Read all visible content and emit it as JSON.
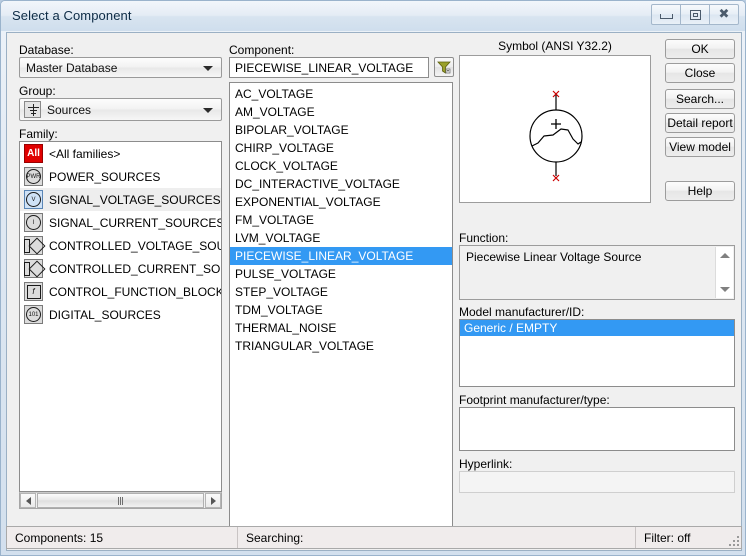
{
  "window": {
    "title": "Select a Component",
    "caption_buttons": [
      {
        "name": "minimize",
        "glyph": "minimize-icon"
      },
      {
        "name": "maximize",
        "glyph": "maximize-icon"
      },
      {
        "name": "close",
        "glyph": "close-icon"
      }
    ]
  },
  "left": {
    "database_label": "Database:",
    "database_value": "Master Database",
    "group_label": "Group:",
    "group_value": "Sources",
    "family_label": "Family:",
    "families": [
      {
        "label": "<All families>",
        "icon": "all-families-icon",
        "badge": "All",
        "selected": false
      },
      {
        "label": "POWER_SOURCES",
        "icon": "power-sources-icon",
        "badge": "PWR",
        "selected": false
      },
      {
        "label": "SIGNAL_VOLTAGE_SOURCES",
        "icon": "signal-voltage-sources-icon",
        "badge": "V",
        "selected": true
      },
      {
        "label": "SIGNAL_CURRENT_SOURCES",
        "icon": "signal-current-sources-icon",
        "badge": "I",
        "selected": false
      },
      {
        "label": "CONTROLLED_VOLTAGE_SOURCES",
        "icon": "controlled-voltage-sources-icon",
        "badge": "",
        "selected": false
      },
      {
        "label": "CONTROLLED_CURRENT_SOURCES",
        "icon": "controlled-current-sources-icon",
        "badge": "",
        "selected": false
      },
      {
        "label": "CONTROL_FUNCTION_BLOCKS",
        "icon": "control-function-blocks-icon",
        "badge": "f",
        "selected": false
      },
      {
        "label": "DIGITAL_SOURCES",
        "icon": "digital-sources-icon",
        "badge": "101",
        "selected": false
      }
    ]
  },
  "component": {
    "label": "Component:",
    "value": "PIECEWISE_LINEAR_VOLTAGE",
    "placeholder": "",
    "filter_icon": "filter-funnel-icon",
    "items": [
      {
        "label": "AC_VOLTAGE",
        "selected": false
      },
      {
        "label": "AM_VOLTAGE",
        "selected": false
      },
      {
        "label": "BIPOLAR_VOLTAGE",
        "selected": false
      },
      {
        "label": "CHIRP_VOLTAGE",
        "selected": false
      },
      {
        "label": "CLOCK_VOLTAGE",
        "selected": false
      },
      {
        "label": "DC_INTERACTIVE_VOLTAGE",
        "selected": false
      },
      {
        "label": "EXPONENTIAL_VOLTAGE",
        "selected": false
      },
      {
        "label": "FM_VOLTAGE",
        "selected": false
      },
      {
        "label": "LVM_VOLTAGE",
        "selected": false
      },
      {
        "label": "PIECEWISE_LINEAR_VOLTAGE",
        "selected": true
      },
      {
        "label": "PULSE_VOLTAGE",
        "selected": false
      },
      {
        "label": "STEP_VOLTAGE",
        "selected": false
      },
      {
        "label": "TDM_VOLTAGE",
        "selected": false
      },
      {
        "label": "THERMAL_NOISE",
        "selected": false
      },
      {
        "label": "TRIANGULAR_VOLTAGE",
        "selected": false
      }
    ]
  },
  "symbol": {
    "title": "Symbol (ANSI Y32.2)",
    "icon": "piecewise-linear-voltage-source-symbol",
    "plus_sign": "+"
  },
  "buttons": [
    {
      "label": "OK",
      "name": "ok-button"
    },
    {
      "label": "Close",
      "name": "close-button"
    },
    {
      "label": "Search...",
      "name": "search-button"
    },
    {
      "label": "Detail report",
      "name": "detail-report-button"
    },
    {
      "label": "View model",
      "name": "view-model-button"
    },
    {
      "label": "Help",
      "name": "help-button"
    }
  ],
  "details": {
    "function_label": "Function:",
    "function_value": "Piecewise Linear Voltage Source",
    "model_label": "Model manufacturer/ID:",
    "model_value": "Generic / EMPTY",
    "footprint_label": "Footprint manufacturer/type:",
    "footprint_value": "",
    "hyperlink_label": "Hyperlink:",
    "hyperlink_value": ""
  },
  "status": {
    "components": "Components: 15",
    "searching": "Searching:",
    "filter": "Filter: off"
  },
  "colors": {
    "selection_blue": "#3399f3",
    "title_text": "#0d2b45",
    "red_accent": "#cc0000"
  }
}
